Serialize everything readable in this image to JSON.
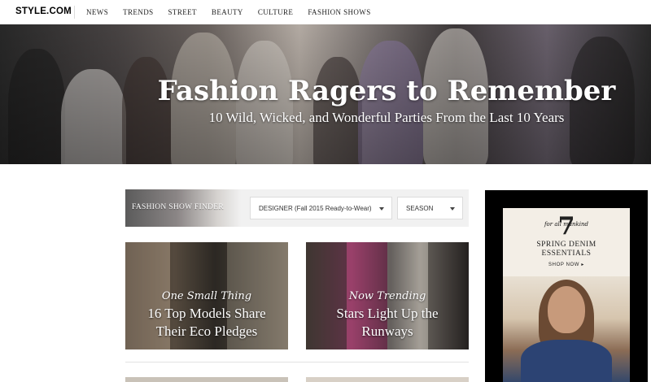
{
  "site": {
    "logo": "STYLE.COM"
  },
  "nav": {
    "items": [
      {
        "label": "NEWS"
      },
      {
        "label": "TRENDS"
      },
      {
        "label": "STREET"
      },
      {
        "label": "BEAUTY"
      },
      {
        "label": "CULTURE"
      },
      {
        "label": "FASHION SHOWS"
      }
    ]
  },
  "hero": {
    "title": "Fashion Ragers to Remember",
    "subtitle": "10 Wild, Wicked, and Wonderful Parties From the Last 10 Years"
  },
  "finder": {
    "label": "FASHION SHOW FINDER",
    "designer_select": "DESIGNER (Fall 2015 Ready-to-Wear)",
    "season_select": "SEASON"
  },
  "stories": [
    {
      "kicker": "One Small Thing",
      "title": "16 Top Models Share Their Eco Pledges"
    },
    {
      "kicker": "Now Trending",
      "title": "Stars Light Up the Runways"
    }
  ],
  "ad": {
    "brand_mark": "7",
    "brand": "for all mankind",
    "headline_line1": "SPRING DENIM",
    "headline_line2": "ESSENTIALS",
    "cta": "SHOP NOW ▸"
  },
  "colors": {
    "background": "#ffffff",
    "nav_text": "#222222",
    "hero_text": "#ffffff",
    "ad_frame": "#000000"
  }
}
